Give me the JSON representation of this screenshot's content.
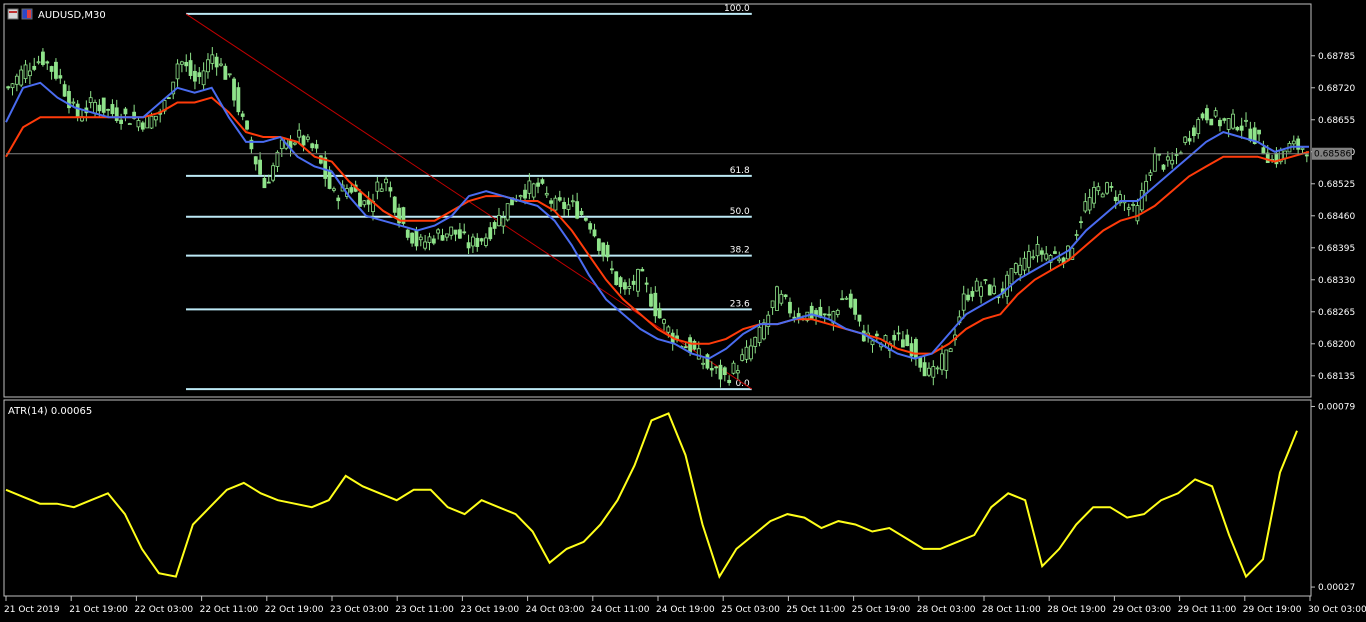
{
  "window": {
    "title": "AUDUSD,M30",
    "indicator_title": "ATR(14) 0.00065"
  },
  "colors": {
    "background": "#000000",
    "frame": "#c0c0c0",
    "candle_up": "#8fe38a",
    "candle_down": "#8fe38a",
    "ma_fast": "#4a6cf0",
    "ma_slow": "#ff3b0a",
    "atr": "#ffff1a",
    "fibo": "#bde9f5",
    "trend": "#c00000",
    "price_line": "#808080"
  },
  "chart_data": [
    {
      "type": "candlestick",
      "title": "AUDUSD,M30",
      "ylim": [
        0.68096,
        0.68882
      ],
      "y_ticks": [
        "0.68785",
        "0.68720",
        "0.68655",
        "0.68590",
        "0.68525",
        "0.68460",
        "0.68395",
        "0.68330",
        "0.68265",
        "0.68200",
        "0.68135"
      ],
      "current_price": "0.68586",
      "x_ticks": [
        "21 Oct 2019",
        "21 Oct 19:00",
        "22 Oct 03:00",
        "22 Oct 11:00",
        "22 Oct 19:00",
        "23 Oct 03:00",
        "23 Oct 11:00",
        "23 Oct 19:00",
        "24 Oct 03:00",
        "24 Oct 11:00",
        "24 Oct 19:00",
        "25 Oct 03:00",
        "25 Oct 11:00",
        "25 Oct 19:00",
        "28 Oct 03:00",
        "28 Oct 11:00",
        "28 Oct 19:00",
        "29 Oct 03:00",
        "29 Oct 11:00",
        "29 Oct 19:00",
        "30 Oct 03:00"
      ],
      "close_path": [
        [
          0,
          0.6872
        ],
        [
          1,
          0.6876
        ],
        [
          2,
          0.6878
        ],
        [
          3,
          0.6874
        ],
        [
          4,
          0.6866
        ],
        [
          5,
          0.6869
        ],
        [
          6,
          0.6867
        ],
        [
          7,
          0.6866
        ],
        [
          8,
          0.6865
        ],
        [
          9,
          0.6867
        ],
        [
          10,
          0.6878
        ],
        [
          11,
          0.6873
        ],
        [
          12,
          0.6879
        ],
        [
          13,
          0.6873
        ],
        [
          14,
          0.6862
        ],
        [
          15,
          0.6852
        ],
        [
          16,
          0.686
        ],
        [
          17,
          0.6862
        ],
        [
          18,
          0.6859
        ],
        [
          19,
          0.685
        ],
        [
          20,
          0.6852
        ],
        [
          21,
          0.6848
        ],
        [
          22,
          0.6854
        ],
        [
          23,
          0.6845
        ],
        [
          24,
          0.684
        ],
        [
          25,
          0.6842
        ],
        [
          26,
          0.6843
        ],
        [
          27,
          0.684
        ],
        [
          28,
          0.6842
        ],
        [
          29,
          0.6847
        ],
        [
          30,
          0.6851
        ],
        [
          31,
          0.6852
        ],
        [
          32,
          0.6848
        ],
        [
          33,
          0.6848
        ],
        [
          34,
          0.6845
        ],
        [
          35,
          0.6837
        ],
        [
          36,
          0.683
        ],
        [
          37,
          0.6834
        ],
        [
          38,
          0.6826
        ],
        [
          39,
          0.6821
        ],
        [
          40,
          0.6819
        ],
        [
          41,
          0.6815
        ],
        [
          42,
          0.6813
        ],
        [
          43,
          0.6817
        ],
        [
          44,
          0.6822
        ],
        [
          45,
          0.683
        ],
        [
          46,
          0.6826
        ],
        [
          47,
          0.6826
        ],
        [
          48,
          0.6825
        ],
        [
          49,
          0.683
        ],
        [
          50,
          0.6822
        ],
        [
          51,
          0.682
        ],
        [
          52,
          0.6821
        ],
        [
          53,
          0.6819
        ],
        [
          54,
          0.6813
        ],
        [
          55,
          0.6818
        ],
        [
          56,
          0.683
        ],
        [
          57,
          0.6832
        ],
        [
          58,
          0.683
        ],
        [
          59,
          0.6835
        ],
        [
          60,
          0.6839
        ],
        [
          61,
          0.6838
        ],
        [
          62,
          0.6838
        ],
        [
          63,
          0.6848
        ],
        [
          64,
          0.6852
        ],
        [
          65,
          0.685
        ],
        [
          66,
          0.6846
        ],
        [
          67,
          0.6858
        ],
        [
          68,
          0.6856
        ],
        [
          69,
          0.6862
        ],
        [
          70,
          0.6867
        ],
        [
          71,
          0.6865
        ],
        [
          72,
          0.6865
        ],
        [
          73,
          0.6862
        ],
        [
          74,
          0.6857
        ],
        [
          75,
          0.686
        ],
        [
          76,
          0.686
        ]
      ],
      "ma_fast_path": [
        [
          0,
          0.6865
        ],
        [
          1,
          0.6872
        ],
        [
          2,
          0.6873
        ],
        [
          3,
          0.687
        ],
        [
          4,
          0.6868
        ],
        [
          5,
          0.6867
        ],
        [
          6,
          0.6866
        ],
        [
          7,
          0.6866
        ],
        [
          8,
          0.6866
        ],
        [
          9,
          0.6869
        ],
        [
          10,
          0.6872
        ],
        [
          11,
          0.6871
        ],
        [
          12,
          0.6872
        ],
        [
          13,
          0.6866
        ],
        [
          14,
          0.6861
        ],
        [
          15,
          0.6861
        ],
        [
          16,
          0.6862
        ],
        [
          17,
          0.6858
        ],
        [
          18,
          0.6856
        ],
        [
          19,
          0.6855
        ],
        [
          20,
          0.685
        ],
        [
          21,
          0.6846
        ],
        [
          22,
          0.6845
        ],
        [
          23,
          0.6844
        ],
        [
          24,
          0.6843
        ],
        [
          25,
          0.6844
        ],
        [
          26,
          0.6846
        ],
        [
          27,
          0.685
        ],
        [
          28,
          0.6851
        ],
        [
          29,
          0.685
        ],
        [
          30,
          0.6849
        ],
        [
          31,
          0.6848
        ],
        [
          32,
          0.6845
        ],
        [
          33,
          0.684
        ],
        [
          34,
          0.6834
        ],
        [
          35,
          0.6829
        ],
        [
          36,
          0.6826
        ],
        [
          37,
          0.6823
        ],
        [
          38,
          0.6821
        ],
        [
          39,
          0.682
        ],
        [
          40,
          0.6818
        ],
        [
          41,
          0.6817
        ],
        [
          42,
          0.6819
        ],
        [
          43,
          0.6822
        ],
        [
          44,
          0.6824
        ],
        [
          45,
          0.6824
        ],
        [
          46,
          0.6825
        ],
        [
          47,
          0.6826
        ],
        [
          48,
          0.6825
        ],
        [
          49,
          0.6823
        ],
        [
          50,
          0.6822
        ],
        [
          51,
          0.682
        ],
        [
          52,
          0.6818
        ],
        [
          53,
          0.6817
        ],
        [
          54,
          0.6818
        ],
        [
          55,
          0.6822
        ],
        [
          56,
          0.6826
        ],
        [
          57,
          0.6828
        ],
        [
          58,
          0.683
        ],
        [
          59,
          0.6833
        ],
        [
          60,
          0.6835
        ],
        [
          61,
          0.6837
        ],
        [
          62,
          0.6839
        ],
        [
          63,
          0.6843
        ],
        [
          64,
          0.6846
        ],
        [
          65,
          0.6849
        ],
        [
          66,
          0.6849
        ],
        [
          67,
          0.6852
        ],
        [
          68,
          0.6855
        ],
        [
          69,
          0.6858
        ],
        [
          70,
          0.6861
        ],
        [
          71,
          0.6863
        ],
        [
          72,
          0.6862
        ],
        [
          73,
          0.6861
        ],
        [
          74,
          0.6859
        ],
        [
          75,
          0.686
        ],
        [
          76,
          0.686
        ]
      ],
      "ma_slow_path": [
        [
          0,
          0.6858
        ],
        [
          1,
          0.6864
        ],
        [
          2,
          0.6866
        ],
        [
          3,
          0.6866
        ],
        [
          4,
          0.6866
        ],
        [
          5,
          0.6866
        ],
        [
          6,
          0.6866
        ],
        [
          7,
          0.6866
        ],
        [
          8,
          0.6866
        ],
        [
          9,
          0.6867
        ],
        [
          10,
          0.6869
        ],
        [
          11,
          0.6869
        ],
        [
          12,
          0.687
        ],
        [
          13,
          0.6867
        ],
        [
          14,
          0.6863
        ],
        [
          15,
          0.6862
        ],
        [
          16,
          0.6862
        ],
        [
          17,
          0.6861
        ],
        [
          18,
          0.6858
        ],
        [
          19,
          0.6857
        ],
        [
          20,
          0.6853
        ],
        [
          21,
          0.685
        ],
        [
          22,
          0.6847
        ],
        [
          23,
          0.6845
        ],
        [
          24,
          0.6845
        ],
        [
          25,
          0.6845
        ],
        [
          26,
          0.6847
        ],
        [
          27,
          0.6849
        ],
        [
          28,
          0.685
        ],
        [
          29,
          0.685
        ],
        [
          30,
          0.6849
        ],
        [
          31,
          0.6849
        ],
        [
          32,
          0.6847
        ],
        [
          33,
          0.6843
        ],
        [
          34,
          0.6838
        ],
        [
          35,
          0.6833
        ],
        [
          36,
          0.6829
        ],
        [
          37,
          0.6826
        ],
        [
          38,
          0.6823
        ],
        [
          39,
          0.6821
        ],
        [
          40,
          0.682
        ],
        [
          41,
          0.682
        ],
        [
          42,
          0.6821
        ],
        [
          43,
          0.6823
        ],
        [
          44,
          0.6824
        ],
        [
          45,
          0.6824
        ],
        [
          46,
          0.6825
        ],
        [
          47,
          0.6825
        ],
        [
          48,
          0.6824
        ],
        [
          49,
          0.6823
        ],
        [
          50,
          0.6822
        ],
        [
          51,
          0.6821
        ],
        [
          52,
          0.6819
        ],
        [
          53,
          0.6818
        ],
        [
          54,
          0.6818
        ],
        [
          55,
          0.682
        ],
        [
          56,
          0.6823
        ],
        [
          57,
          0.6825
        ],
        [
          58,
          0.6826
        ],
        [
          59,
          0.683
        ],
        [
          60,
          0.6833
        ],
        [
          61,
          0.6835
        ],
        [
          62,
          0.6837
        ],
        [
          63,
          0.684
        ],
        [
          64,
          0.6843
        ],
        [
          65,
          0.6845
        ],
        [
          66,
          0.6846
        ],
        [
          67,
          0.6848
        ],
        [
          68,
          0.6851
        ],
        [
          69,
          0.6854
        ],
        [
          70,
          0.6856
        ],
        [
          71,
          0.6858
        ],
        [
          72,
          0.6858
        ],
        [
          73,
          0.6858
        ],
        [
          74,
          0.6857
        ],
        [
          75,
          0.6858
        ],
        [
          76,
          0.6859
        ]
      ],
      "fibonacci": {
        "levels": [
          {
            "label": "100.0",
            "value": 0.6887
          },
          {
            "label": "61.8",
            "value": 0.68541
          },
          {
            "label": "50.0",
            "value": 0.68458
          },
          {
            "label": "38.2",
            "value": 0.68379
          },
          {
            "label": "23.6",
            "value": 0.6827
          },
          {
            "label": "0.0",
            "value": 0.68108
          }
        ]
      }
    },
    {
      "type": "line",
      "title": "ATR(14) 0.00065",
      "ylim": [
        0.00025,
        0.0008
      ],
      "y_ticks": [
        "0.00079",
        "0.00027"
      ],
      "values": [
        0.00055,
        0.00053,
        0.00051,
        0.00051,
        0.0005,
        0.00052,
        0.00054,
        0.00048,
        0.00038,
        0.00031,
        0.0003,
        0.00045,
        0.0005,
        0.00055,
        0.00057,
        0.00054,
        0.00052,
        0.00051,
        0.0005,
        0.00052,
        0.00059,
        0.00056,
        0.00054,
        0.00052,
        0.00055,
        0.00055,
        0.0005,
        0.00048,
        0.00052,
        0.0005,
        0.00048,
        0.00043,
        0.00034,
        0.00038,
        0.0004,
        0.00045,
        0.00052,
        0.00062,
        0.00075,
        0.00077,
        0.00065,
        0.00045,
        0.0003,
        0.00038,
        0.00042,
        0.00046,
        0.00048,
        0.00047,
        0.00044,
        0.00046,
        0.00045,
        0.00043,
        0.00044,
        0.00041,
        0.00038,
        0.00038,
        0.0004,
        0.00042,
        0.0005,
        0.00054,
        0.00052,
        0.00033,
        0.00038,
        0.00045,
        0.0005,
        0.0005,
        0.00047,
        0.00048,
        0.00052,
        0.00054,
        0.00058,
        0.00056,
        0.00042,
        0.0003,
        0.00035,
        0.0006,
        0.00072
      ]
    }
  ]
}
